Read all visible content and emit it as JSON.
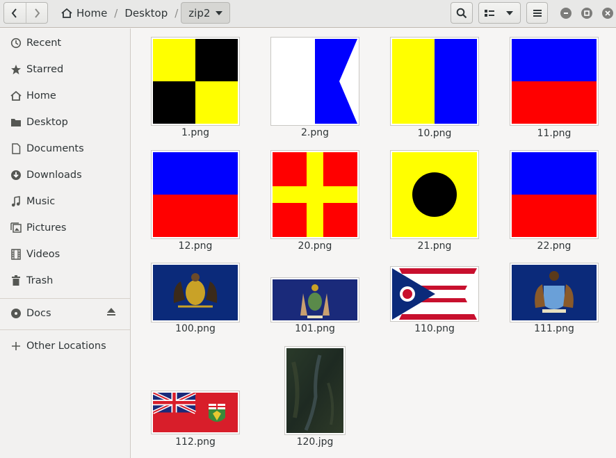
{
  "nav": {
    "back": "back",
    "forward": "forward"
  },
  "breadcrumb": {
    "home": "Home",
    "desktop": "Desktop",
    "current": "zip2"
  },
  "sidebar": {
    "items": [
      {
        "label": "Recent",
        "icon": "clock-icon"
      },
      {
        "label": "Starred",
        "icon": "star-icon"
      },
      {
        "label": "Home",
        "icon": "home-icon"
      },
      {
        "label": "Desktop",
        "icon": "folder-icon"
      },
      {
        "label": "Documents",
        "icon": "document-icon"
      },
      {
        "label": "Downloads",
        "icon": "download-icon"
      },
      {
        "label": "Music",
        "icon": "music-icon"
      },
      {
        "label": "Pictures",
        "icon": "pictures-icon"
      },
      {
        "label": "Videos",
        "icon": "film-icon"
      },
      {
        "label": "Trash",
        "icon": "trash-icon"
      }
    ],
    "devices": [
      {
        "label": "Docs",
        "icon": "disk-icon"
      }
    ],
    "other": {
      "label": "Other Locations",
      "icon": "plus-icon"
    }
  },
  "files": [
    {
      "name": "1.png"
    },
    {
      "name": "2.png"
    },
    {
      "name": "10.png"
    },
    {
      "name": "11.png"
    },
    {
      "name": "12.png"
    },
    {
      "name": "20.png"
    },
    {
      "name": "21.png"
    },
    {
      "name": "22.png"
    },
    {
      "name": "100.png"
    },
    {
      "name": "101.png"
    },
    {
      "name": "110.png"
    },
    {
      "name": "111.png"
    },
    {
      "name": "112.png"
    },
    {
      "name": "120.jpg"
    }
  ],
  "colors": {
    "yellow": "#ffff00",
    "black": "#000000",
    "blue": "#0000ff",
    "red": "#ff0000",
    "navy": "#1a2a7a"
  }
}
